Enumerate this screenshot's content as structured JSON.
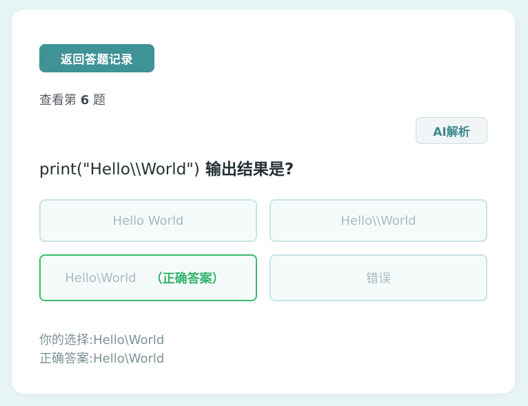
{
  "back_button": {
    "label": "返回答题记录"
  },
  "viewing": {
    "prefix": "查看第",
    "number": "6",
    "suffix": "题"
  },
  "ai_button": {
    "label": "AI解析"
  },
  "question": {
    "code": "print(\"Hello\\\\World\")",
    "text": "输出结果是?"
  },
  "options": [
    {
      "text": "Hello World"
    },
    {
      "text": "Hello\\\\World"
    },
    {
      "text": "Hello\\World",
      "tag": "（正确答案）"
    },
    {
      "text": "错误"
    }
  ],
  "summary": {
    "your_choice_label": "你的选择:",
    "your_choice_value": "Hello\\World",
    "correct_answer_label": "正确答案:",
    "correct_answer_value": "Hello\\World"
  },
  "colors": {
    "accent": "#3f9295",
    "correct": "#33b36a",
    "background": "#e6f4f4"
  }
}
